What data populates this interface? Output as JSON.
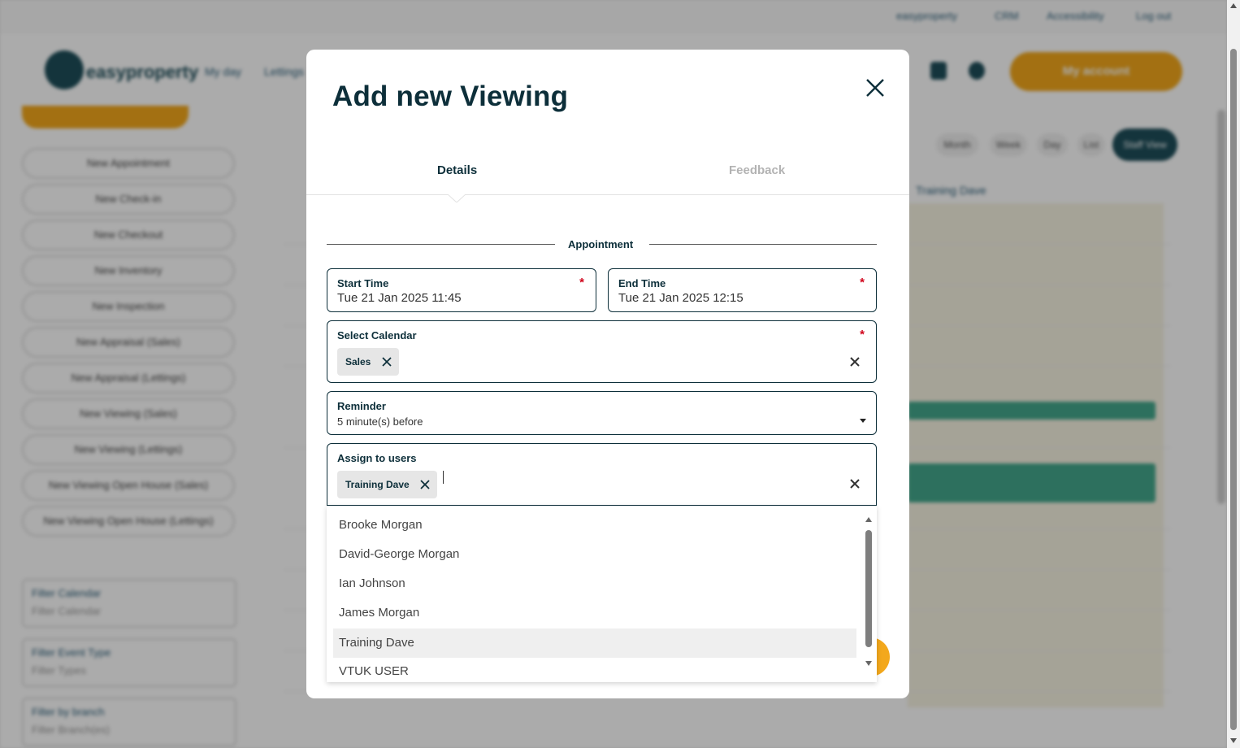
{
  "background": {
    "top_links": [
      "easyproperty",
      "CRM",
      "Accessibility",
      "Log out"
    ],
    "logo_text": "easyproperty",
    "nav_links": [
      "My day",
      "Lettings"
    ],
    "account_button": "My account",
    "sidebar_buttons": [
      "New Appointment",
      "New Check-in",
      "New Checkout",
      "New Inventory",
      "New Inspection",
      "New Appraisal (Sales)",
      "New Appraisal (Lettings)",
      "New Viewing (Sales)",
      "New Viewing (Lettings)",
      "New Viewing Open House (Sales)",
      "New Viewing Open House (Lettings)"
    ],
    "filters": [
      {
        "label": "Filter Calendar",
        "placeholder": "Filter Calendar"
      },
      {
        "label": "Filter Event Type",
        "placeholder": "Filter Types"
      },
      {
        "label": "Filter by branch",
        "placeholder": "Filter Branch(es)"
      }
    ],
    "calendar_views": [
      "Month",
      "Week",
      "Day",
      "List",
      "Staff View"
    ],
    "calendar_column_header": "Training Dave"
  },
  "modal": {
    "title": "Add new Viewing",
    "tabs": [
      {
        "label": "Details",
        "active": true
      },
      {
        "label": "Feedback",
        "active": false
      }
    ],
    "section_title": "Appointment",
    "start_time": {
      "label": "Start Time",
      "value": "Tue 21 Jan 2025 11:45",
      "required_mark": "*"
    },
    "end_time": {
      "label": "End Time",
      "value": "Tue 21 Jan 2025 12:15",
      "required_mark": "*"
    },
    "select_calendar": {
      "label": "Select Calendar",
      "chip": "Sales",
      "required_mark": "*"
    },
    "reminder": {
      "label": "Reminder",
      "value": "5 minute(s) before"
    },
    "assign_users": {
      "label": "Assign to users",
      "chip": "Training Dave",
      "options": [
        "Brooke Morgan",
        "David-George Morgan",
        "Ian Johnson",
        "James Morgan",
        "Training Dave",
        "VTUK USER"
      ],
      "highlighted": "Training Dave"
    }
  },
  "colors": {
    "brand_dark": "#0d2f3a",
    "accent": "#f3a81c",
    "required": "#d0021b",
    "chip_bg": "#e6e6e6"
  }
}
